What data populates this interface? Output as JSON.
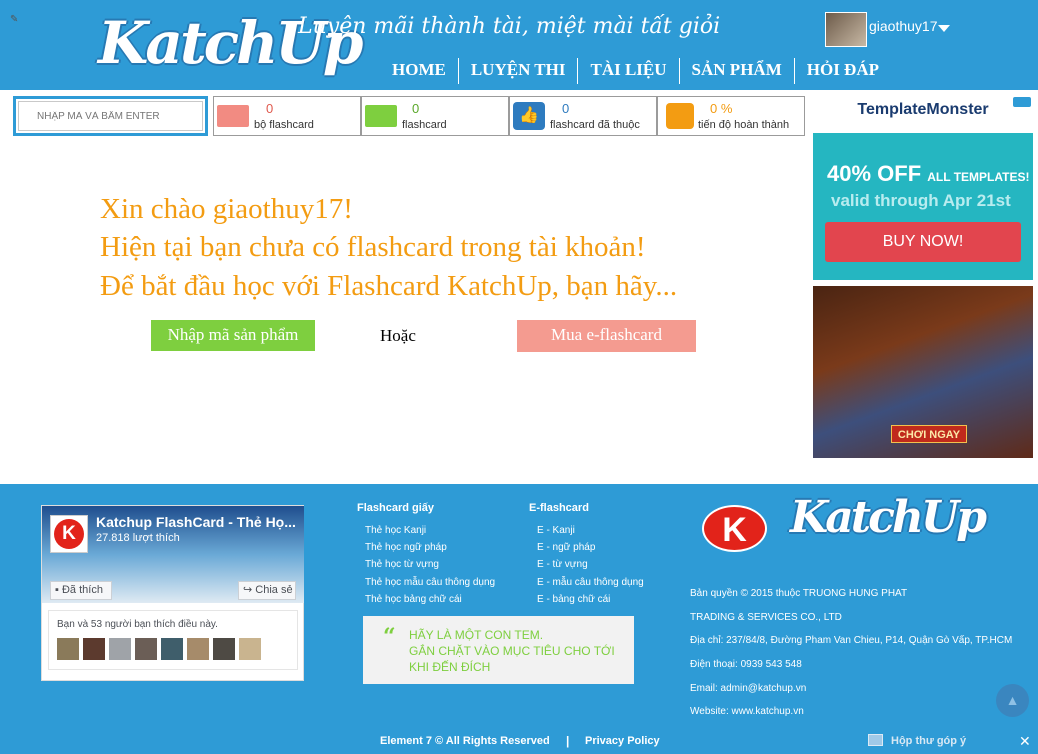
{
  "header": {
    "logo": "KatchUp",
    "slogan": "Luyện mãi thành tài, miệt mài tất giỏi",
    "username": "giaothuy17",
    "nav": [
      "HOME",
      "LUYỆN THI",
      "TÀI LIỆU",
      "SẢN PHẨM",
      "HỎI ĐÁP"
    ]
  },
  "stats": {
    "code_placeholder": "NHẬP MÃ VÀ BẤM ENTER",
    "items": [
      {
        "value": "0",
        "label": "bộ flashcard",
        "icon": "flashcard-deck-icon",
        "color": "#f28b82"
      },
      {
        "value": "0",
        "label": "flashcard",
        "icon": "flashcard-icon",
        "color": "#7ecf3f"
      },
      {
        "value": "0",
        "label": "flashcard đã thuộc",
        "icon": "thumbs-up-icon",
        "color": "#2e7bbf"
      },
      {
        "value": "0 %",
        "label": "tiến độ hoàn thành",
        "icon": "progress-chart-icon",
        "color": "#f39c12"
      }
    ]
  },
  "welcome": {
    "line1": "Xin chào giaothuy17!",
    "line2": "Hiện tại bạn chưa có flashcard trong tài khoản!",
    "line3": "Để bắt đầu học với Flashcard KatchUp, bạn hãy...",
    "enter_code_button": "Nhập mã sản phẩm",
    "or": "Hoặc",
    "buy_button": "Mua e-flashcard"
  },
  "ads": {
    "ad1": {
      "brand": "TemplateMonster",
      "offer": "40% OFF",
      "offer_small": "ALL TEMPLATES!",
      "valid": "valid through Apr 21st",
      "button": "BUY NOW!"
    },
    "ad2": {
      "button": "CHƠI NGAY"
    }
  },
  "footer": {
    "facebook": {
      "page_name": "Katchup FlashCard - Thẻ Họ...",
      "likes": "27.818 lượt thích",
      "like_button": "Đã thích",
      "share_button": "Chia sẻ",
      "friends_text": "Bạn và 53 người bạn thích điều này."
    },
    "columns": [
      {
        "title": "Flashcard giấy",
        "links": [
          "Thẻ học Kanji",
          "Thẻ học ngữ pháp",
          "Thẻ học từ vựng",
          "Thẻ học mẫu câu thông dụng",
          "Thẻ học bảng chữ cái"
        ]
      },
      {
        "title": "E-flashcard",
        "links": [
          "E - Kanji",
          "E - ngữ pháp",
          "E - từ vựng",
          "E - mẫu câu thông dụng",
          "E - bảng chữ cái"
        ]
      }
    ],
    "quote": [
      "HÃY LÀ MỘT CON TEM.",
      "GẮN CHẶT VÀO MỤC TIÊU CHO TỚI",
      "KHI ĐẾN ĐÍCH"
    ],
    "k_logo": "K",
    "logo": "KatchUp",
    "company": [
      "Bản quyền © 2015 thuộc TRUONG HUNG PHAT",
      "TRADING & SERVICES CO., LTD",
      "Địa chỉ: 237/84/8, Đường Pham Van Chieu, P14, Quận Gò Vấp, TP.HCM",
      "Điện thoại: 0939 543 548",
      "Email: admin@katchup.vn",
      "Website: www.katchup.vn"
    ],
    "copyright": "Element 7 © All Rights Reserved",
    "separator": "|",
    "privacy": "Privacy Policy",
    "feedback": "Hộp thư góp ý",
    "close": "✕",
    "scroll_top": "▲"
  }
}
